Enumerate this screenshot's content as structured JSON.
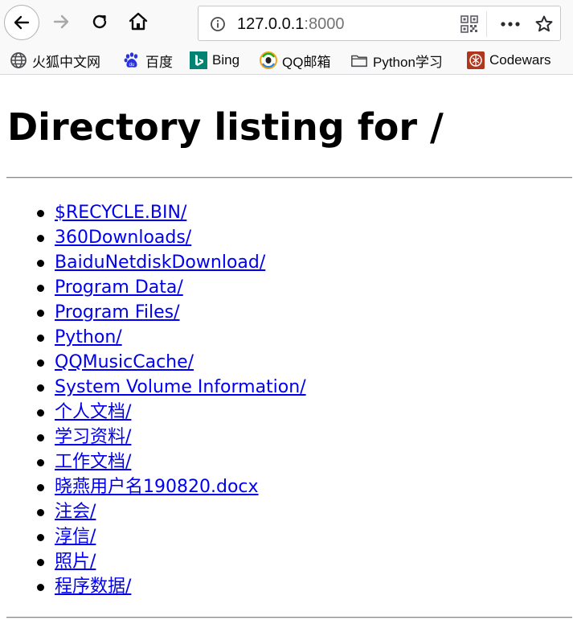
{
  "browser": {
    "url_host": "127.0.0.1",
    "url_port": ":8000",
    "icons": {
      "back": "back-arrow-icon",
      "forward": "forward-arrow-icon",
      "reload": "reload-icon",
      "home": "home-icon",
      "info": "info-icon",
      "qr": "qr-code-icon",
      "more": "more-dots-icon",
      "bookmark_star": "star-icon"
    },
    "bookmarks": [
      {
        "label": "火狐中文网",
        "icon": "globe-icon"
      },
      {
        "label": "百度",
        "icon": "baidu-paw-icon"
      },
      {
        "label": "Bing",
        "icon": "bing-icon"
      },
      {
        "label": "QQ邮箱",
        "icon": "qq-mail-icon"
      },
      {
        "label": "Python学习",
        "icon": "folder-icon"
      },
      {
        "label": "Codewars",
        "icon": "codewars-icon"
      }
    ]
  },
  "page": {
    "title": "Directory listing for /",
    "items": [
      "$RECYCLE.BIN/",
      "360Downloads/",
      "BaiduNetdiskDownload/",
      "Program Data/",
      "Program Files/",
      "Python/",
      "QQMusicCache/",
      "System Volume Information/",
      "个人文档/",
      "学习资料/",
      "工作文档/",
      "晓燕用户名190820.docx",
      "注会/",
      "淳信/",
      "照片/",
      "程序数据/"
    ]
  },
  "colors": {
    "link": "#0000ee",
    "toolbar_bg": "#f9f9fa",
    "codewars_red": "#b1361e",
    "bing_teal": "#008373",
    "baidu_blue": "#2932e1"
  }
}
